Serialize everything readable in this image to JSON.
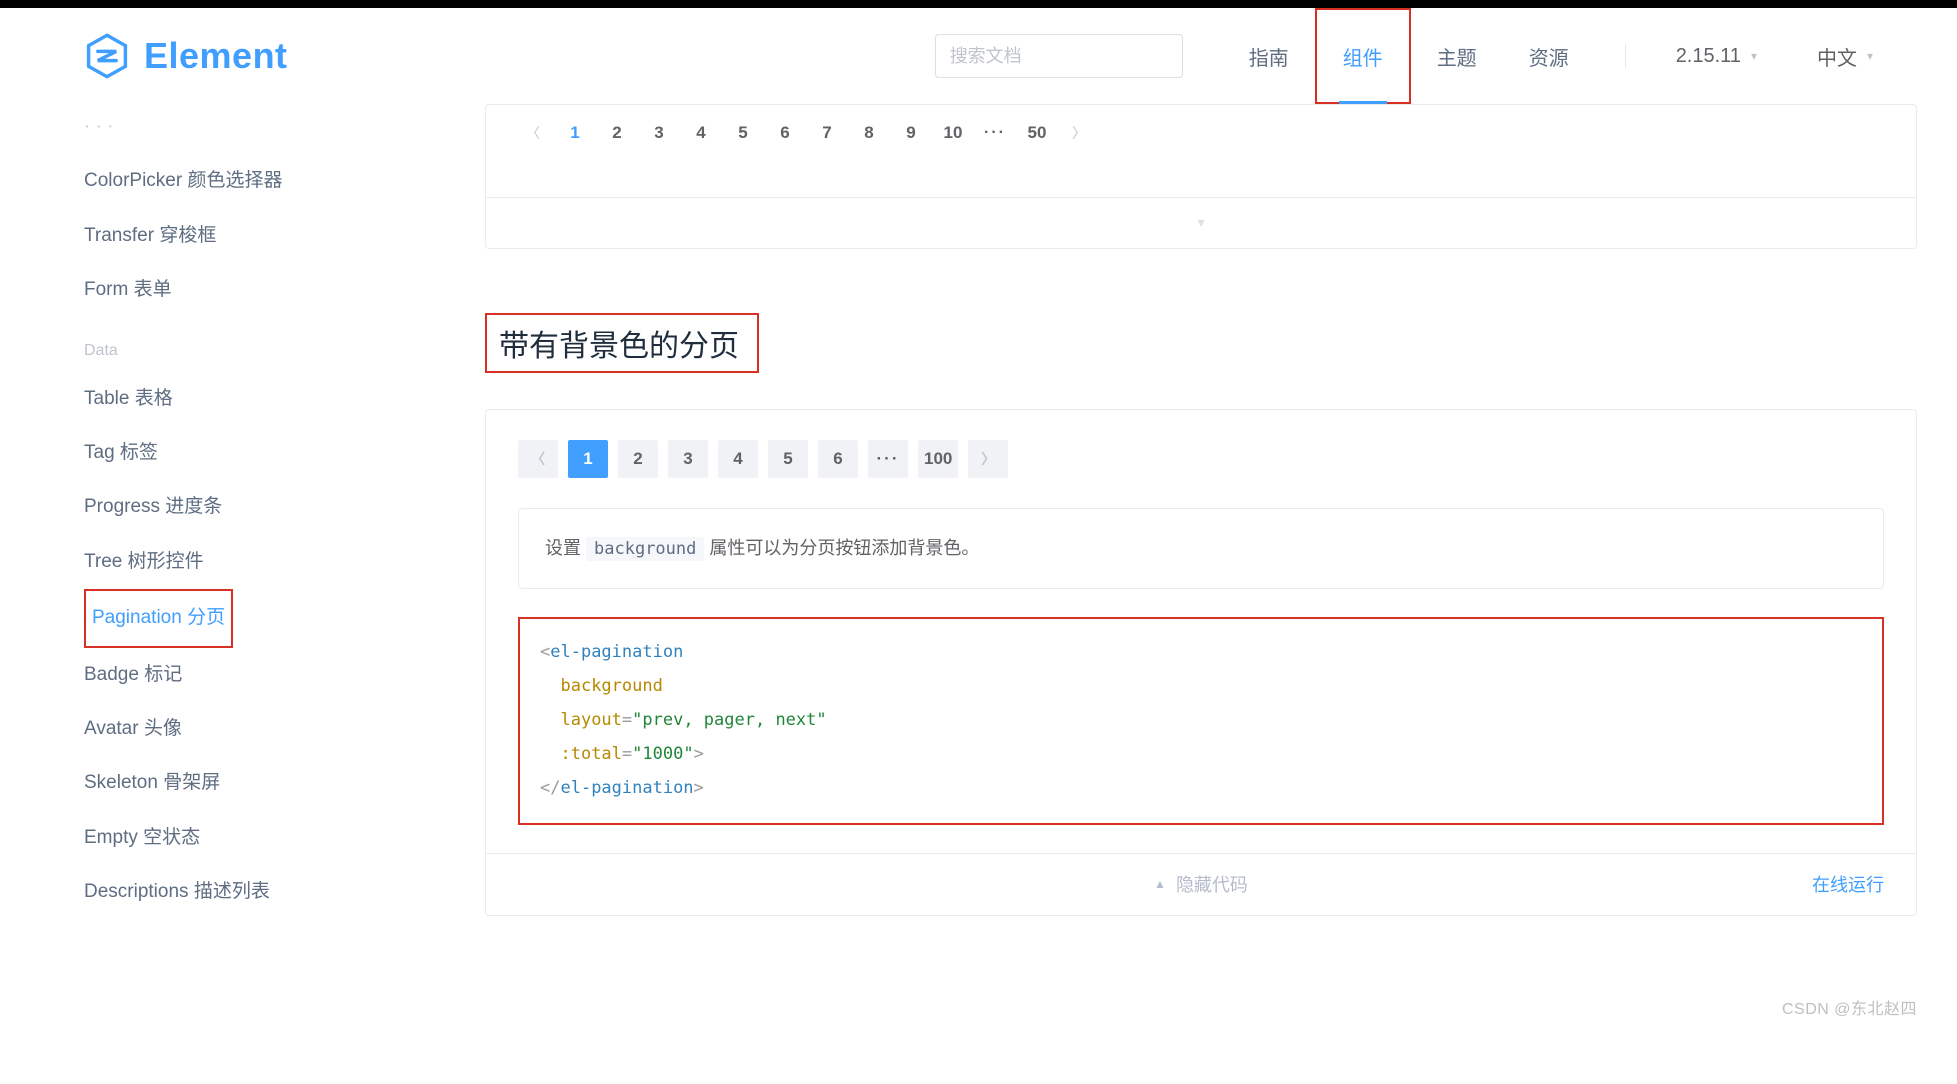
{
  "header": {
    "logo_text": "Element",
    "search_placeholder": "搜索文档",
    "nav": [
      "指南",
      "组件",
      "主题",
      "资源"
    ],
    "nav_active": "组件",
    "version": "2.15.11",
    "language": "中文"
  },
  "sidebar": {
    "items_top": [
      "ColorPicker 颜色选择器",
      "Transfer 穿梭框",
      "Form 表单"
    ],
    "group_label": "Data",
    "items_data": [
      "Table 表格",
      "Tag 标签",
      "Progress 进度条",
      "Tree 树形控件",
      "Pagination 分页",
      "Badge 标记",
      "Avatar 头像",
      "Skeleton 骨架屏",
      "Empty 空状态",
      "Descriptions 描述列表"
    ],
    "active": "Pagination 分页"
  },
  "plain_pagination": {
    "pages": [
      "1",
      "2",
      "3",
      "4",
      "5",
      "6",
      "7",
      "8",
      "9",
      "10"
    ],
    "more": "···",
    "last": "50"
  },
  "section_title": "带有背景色的分页",
  "bg_pagination": {
    "pages": [
      "1",
      "2",
      "3",
      "4",
      "5",
      "6"
    ],
    "more": "···",
    "last": "100"
  },
  "description": {
    "prefix": "设置",
    "chip": "background",
    "suffix": "属性可以为分页按钮添加背景色。"
  },
  "code": {
    "open_lt": "<",
    "tag": "el-pagination",
    "attr_bg": "background",
    "attr_layout_name": "layout",
    "attr_layout_val": "\"prev, pager, next\"",
    "attr_total_name": ":total",
    "attr_total_val": "\"1000\"",
    "close_gt": ">",
    "close_open": "</",
    "eq": "="
  },
  "footer": {
    "hide_code": "隐藏代码",
    "run_online": "在线运行"
  },
  "watermark": "CSDN @东北赵四"
}
